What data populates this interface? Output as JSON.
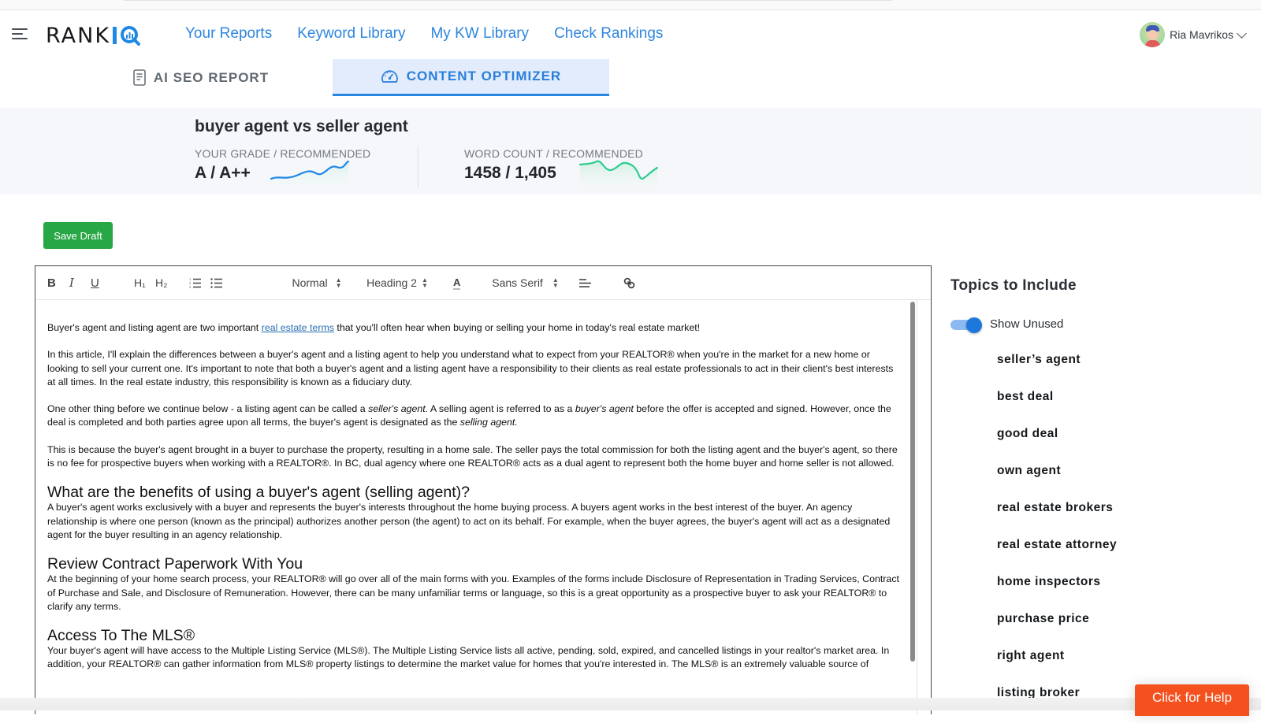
{
  "header": {
    "logo_text": "RANK",
    "logo_suffix": "IQ",
    "nav": [
      {
        "label": "Your Reports"
      },
      {
        "label": "Keyword Library"
      },
      {
        "label": "My KW Library"
      },
      {
        "label": "Check Rankings"
      }
    ],
    "user_name": "Ria Mavrikos",
    "brand_color": "#1e88e5"
  },
  "tabs": [
    {
      "label": "AI SEO REPORT",
      "icon": "document-icon",
      "active": false
    },
    {
      "label": "CONTENT OPTIMIZER",
      "icon": "speedometer-icon",
      "active": true
    }
  ],
  "summary": {
    "keyword": "buyer agent vs seller agent",
    "grade_label": "YOUR GRADE / RECOMMENDED",
    "grade_value": "A / A++",
    "grade_color": "#1e88e5",
    "words_label": "WORD COUNT / RECOMMENDED",
    "words_value": "1458 / 1,405",
    "words_color": "#2ecc8f"
  },
  "actions": {
    "save_draft": "Save Draft"
  },
  "toolbar": {
    "bold": "B",
    "italic": "I",
    "underline": "U",
    "h1": "H₁",
    "h2": "H₂",
    "size_select": "Normal",
    "heading_select": "Heading 2",
    "color_glyph": "A",
    "font_select": "Sans Serif"
  },
  "content": {
    "p1_before": "Buyer's agent and listing agent are two important ",
    "p1_link": "real estate terms",
    "p1_after": " that you'll often hear when buying or selling your home in today's real estate market!",
    "p2": "In this article, I'll explain the differences between a buyer's agent and a listing agent to help you understand what to expect from your REALTOR® when you're in the market for a new home or looking to sell your current one. It's important to note that both a buyer's agent and a listing agent have a responsibility to their clients as real estate professionals to act in their client's best interests at all times. In the real estate industry, this responsibility is known as a fiduciary duty.",
    "p3_a": "One other thing before we continue below - a listing agent can be called a ",
    "p3_em1": "seller's agent.",
    "p3_b": " A selling agent is referred to as a ",
    "p3_em2": "buyer's agent",
    "p3_c": " before the offer is accepted and signed. However, once the deal is completed and both parties agree upon all terms, the buyer's agent is designated as the ",
    "p3_em3": "selling agent.",
    "p4": "This is because the buyer's agent brought in a buyer to purchase the property, resulting in a home sale. The seller pays the total commission for both the listing agent and the buyer's agent, so there is no fee for prospective buyers when working with a REALTOR®. In BC, dual agency where one REALTOR® acts as a dual agent to represent both the home buyer and home seller is not allowed.",
    "h_benefits": "What are the benefits of using a buyer's agent (selling agent)?",
    "p5": "A buyer's agent works exclusively with a buyer and represents the buyer's interests throughout the home buying process. A buyers agent works in the best interest of the buyer. An agency relationship is where one person (known as the principal) authorizes another person (the agent) to act on its behalf. For example, when the buyer agrees, the buyer's agent will act as a designated agent for the buyer resulting in an agency relationship.",
    "h_review": "Review Contract Paperwork With You",
    "p6": "At the beginning of your home search process, your REALTOR® will go over all of the main forms with you. Examples of the forms include Disclosure of Representation in Trading Services, Contract of Purchase and Sale, and Disclosure of Remuneration. However, there can be many unfamiliar terms or language, so this is a great opportunity as a prospective buyer to ask your REALTOR® to clarify any terms.",
    "h_mls": "Access To The MLS®",
    "p7": "Your buyer's agent will have access to the Multiple Listing Service (MLS®). The Multiple Listing Service lists all active, pending, sold, expired, and cancelled listings in your realtor's market area. In addition, your REALTOR® can gather information from MLS® property listings to determine the market value for homes that you're interested in. The MLS® is an extremely valuable source of"
  },
  "topics": {
    "title": "Topics to Include",
    "toggle_label": "Show Unused",
    "toggle_on": true,
    "items": [
      "seller’s agent",
      "best deal",
      "good deal",
      "own agent",
      "real estate brokers",
      "real estate attorney",
      "home inspectors",
      "purchase price",
      "right agent",
      "listing broker"
    ]
  },
  "help": {
    "label": "Click for Help"
  }
}
